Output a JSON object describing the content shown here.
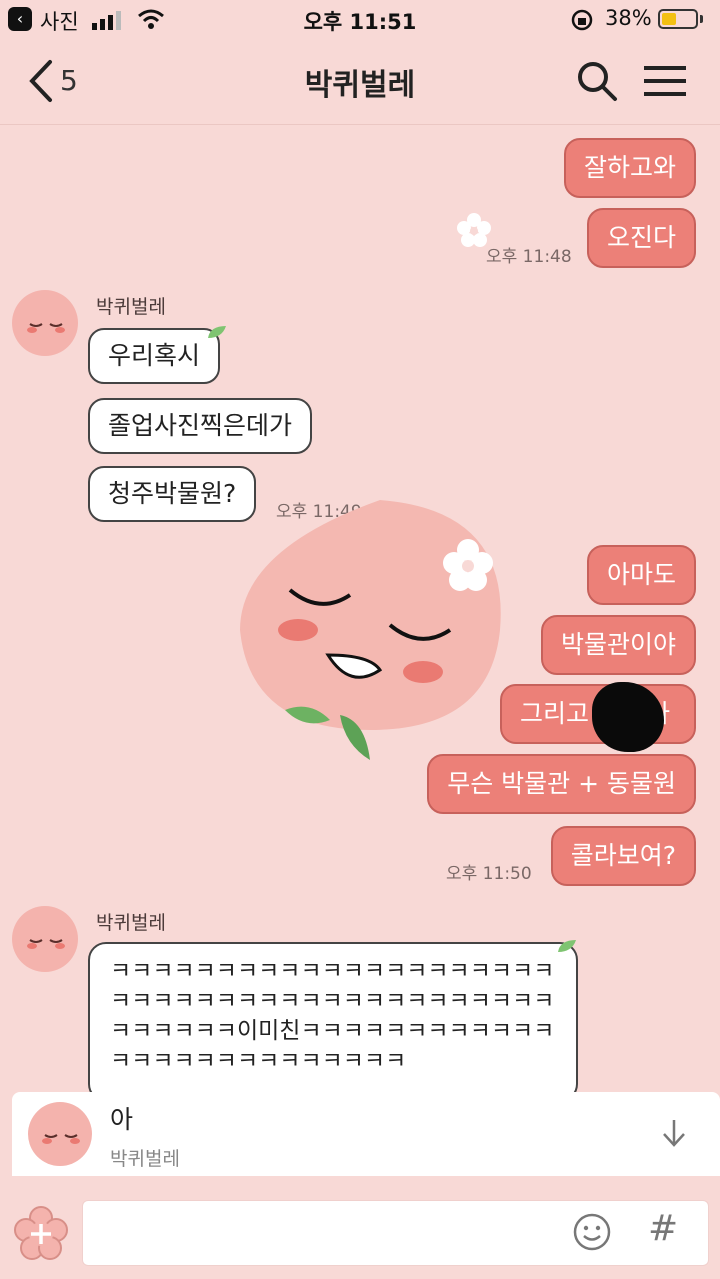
{
  "status_bar": {
    "back_app": "사진",
    "time": "오후 11:51",
    "battery": "38%",
    "battery_level": 0.38
  },
  "header": {
    "unread_count": "5",
    "title": "박퀴벌레"
  },
  "messages": {
    "me1": "잘하고와",
    "me2": "오진다",
    "me_time1": "오후 11:48",
    "you_name1": "박퀴벌레",
    "you1": "우리혹시",
    "you2": "졸업사진찍은데가",
    "you3": "청주박물원?",
    "you_time1": "오후 11:49",
    "me3": "아마도",
    "me4": "박물관이야",
    "me5": "그리고",
    "me5_tail": "아",
    "me6": "무슨 박물관 + 동물원",
    "me7": "콜라보여?",
    "me_time2": "오후 11:50",
    "you_name2": "박퀴벌레",
    "long_text": "ㅋㅋㅋㅋㅋㅋㅋㅋㅋㅋㅋㅋㅋㅋㅋㅋㅋㅋㅋㅋㅋㅋㅋㅋㅋㅋㅋㅋㅋㅋㅋㅋㅋㅋㅋㅋㅋㅋㅋㅋㅋㅋㅋㅋㅋㅋㅋㅋ이미친ㅋㅋㅋㅋㅋㅋㅋㅋㅋㅋㅋㅋㅋㅋㅋㅋㅋㅋㅋㅋㅋㅋㅋㅋㅋㅋ"
  },
  "reply_preview": {
    "text": "아",
    "sender": "박퀴벌레"
  },
  "composer": {
    "placeholder": "",
    "hash": "#"
  },
  "colors": {
    "background": "#f8d9d6",
    "my_bubble": "#ec8078",
    "their_bubble": "#ffffff"
  },
  "icons": [
    "back-icon",
    "search-icon",
    "menu-icon",
    "emoji-icon",
    "hash-icon",
    "plus-icon",
    "scroll-down-icon"
  ]
}
